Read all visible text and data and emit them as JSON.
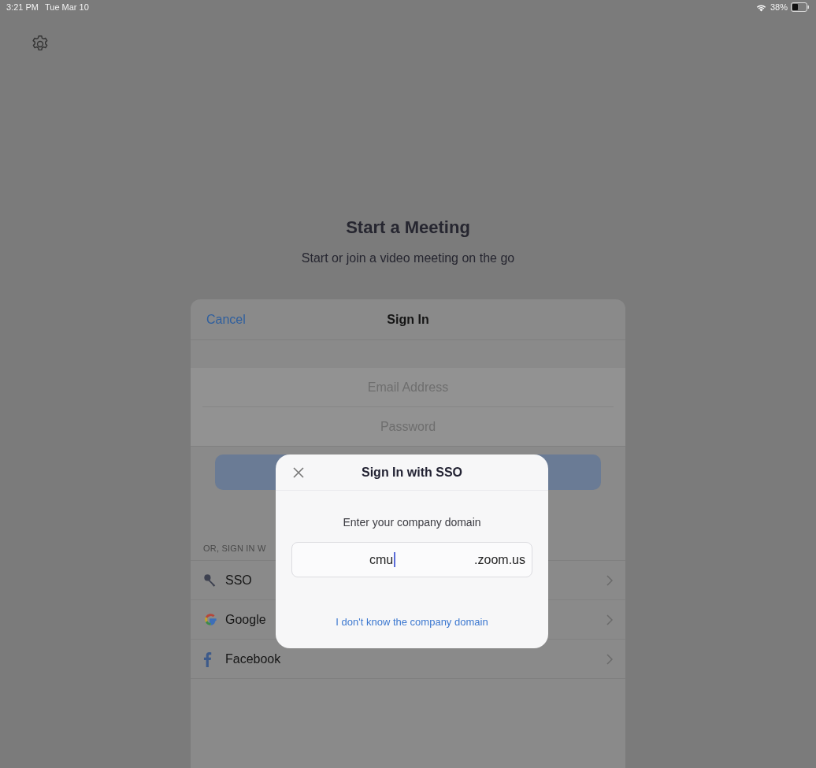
{
  "status_bar": {
    "time": "3:21 PM",
    "date": "Tue Mar 10",
    "battery_text": "38%"
  },
  "hero": {
    "title": "Start a Meeting",
    "subtitle": "Start or join a video meeting on the go"
  },
  "sign_in_sheet": {
    "cancel": "Cancel",
    "title": "Sign In",
    "fields": [
      {
        "placeholder": "Email Address"
      },
      {
        "placeholder": "Password"
      }
    ],
    "section_label": "OR, SIGN IN W",
    "providers": [
      {
        "kind": "key",
        "label": "SSO"
      },
      {
        "kind": "google",
        "label": "Google"
      },
      {
        "kind": "facebook",
        "label": "Facebook"
      }
    ]
  },
  "sso_dialog": {
    "title": "Sign In with SSO",
    "prompt": "Enter your company domain",
    "domain_value": "cmu",
    "domain_suffix": ".zoom.us",
    "help_link": "I don't know the company domain"
  }
}
